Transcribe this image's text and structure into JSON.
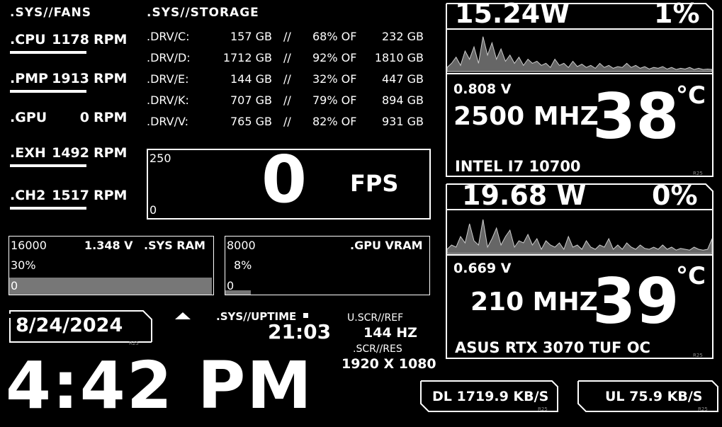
{
  "fans": {
    "header": ".SYS//FANS",
    "items": [
      {
        "label": ".CPU",
        "rpm": "1178",
        "unit": "RPM"
      },
      {
        "label": ".PMP",
        "rpm": "1913",
        "unit": "RPM"
      },
      {
        "label": ".GPU",
        "rpm": "0",
        "unit": "RPM"
      },
      {
        "label": ".EXH",
        "rpm": "1492",
        "unit": "RPM"
      },
      {
        "label": ".CH2",
        "rpm": "1517",
        "unit": "RPM"
      }
    ]
  },
  "storage": {
    "header": ".SYS//STORAGE",
    "drives": [
      {
        "name": ".DRV/C:",
        "used": "157 GB",
        "sep": "//",
        "pct": "68% OF",
        "total": "232 GB"
      },
      {
        "name": ".DRV/D:",
        "used": "1712 GB",
        "sep": "//",
        "pct": "92% OF",
        "total": "1810 GB"
      },
      {
        "name": ".DRV/E:",
        "used": "144 GB",
        "sep": "//",
        "pct": "32% OF",
        "total": "447 GB"
      },
      {
        "name": ".DRV/K:",
        "used": "707 GB",
        "sep": "//",
        "pct": "79% OF",
        "total": "894 GB"
      },
      {
        "name": ".DRV/V:",
        "used": "765 GB",
        "sep": "//",
        "pct": "82% OF",
        "total": "931 GB"
      }
    ]
  },
  "fps": {
    "max": "250",
    "min": "0",
    "value": "0",
    "unit": "FPS"
  },
  "ram": {
    "max": "16000",
    "voltage": "1.348 V",
    "label": ".SYS RAM",
    "pct": "30%",
    "min": "0",
    "fill": 1.0
  },
  "vram": {
    "max": "8000",
    "label": ".GPU VRAM",
    "pct": "8%",
    "min": "0",
    "fill": 0.08
  },
  "cpu": {
    "power": "15.24W",
    "load": "1%",
    "voltage": "0.808 V",
    "clock": "2500 MHZ",
    "temp": "38",
    "temp_unit": "°C",
    "name": "INTEL I7 10700",
    "tag": "R25",
    "graph": [
      0.1,
      0.2,
      0.35,
      0.15,
      0.5,
      0.3,
      0.6,
      0.2,
      0.85,
      0.4,
      0.7,
      0.3,
      0.55,
      0.25,
      0.4,
      0.2,
      0.35,
      0.15,
      0.3,
      0.2,
      0.25,
      0.15,
      0.2,
      0.1,
      0.3,
      0.15,
      0.2,
      0.1,
      0.25,
      0.12,
      0.18,
      0.1,
      0.15,
      0.08,
      0.2,
      0.1,
      0.15,
      0.08,
      0.12,
      0.1,
      0.2,
      0.1,
      0.15,
      0.08,
      0.12,
      0.06,
      0.1,
      0.08,
      0.12,
      0.06,
      0.1,
      0.05,
      0.08,
      0.06,
      0.1,
      0.05,
      0.08,
      0.05,
      0.06,
      0.05
    ]
  },
  "gpu": {
    "power": "19.68 W",
    "load": "0%",
    "voltage": "0.669 V",
    "clock": "210 MHZ",
    "temp": "39",
    "temp_unit": "°C",
    "name": "ASUS RTX 3070 TUF OC",
    "tag": "R25",
    "graph": [
      0.1,
      0.2,
      0.15,
      0.4,
      0.25,
      0.7,
      0.3,
      0.2,
      0.8,
      0.15,
      0.35,
      0.6,
      0.2,
      0.4,
      0.55,
      0.15,
      0.3,
      0.25,
      0.45,
      0.2,
      0.35,
      0.1,
      0.3,
      0.2,
      0.15,
      0.25,
      0.1,
      0.4,
      0.15,
      0.2,
      0.1,
      0.3,
      0.15,
      0.1,
      0.2,
      0.15,
      0.35,
      0.1,
      0.2,
      0.1,
      0.25,
      0.15,
      0.1,
      0.2,
      0.12,
      0.1,
      0.15,
      0.1,
      0.2,
      0.1,
      0.15,
      0.08,
      0.12,
      0.1,
      0.08,
      0.15,
      0.1,
      0.08,
      0.1,
      0.35
    ]
  },
  "date": {
    "value": "8/24/2024",
    "tag": "R25"
  },
  "time": {
    "value": "4:42 PM"
  },
  "uptime": {
    "label": ".SYS//UPTIME",
    "value": "21:03"
  },
  "screen": {
    "ref_label": "U.SCR//REF",
    "ref_value": "144 HZ",
    "res_label": ".SCR//RES",
    "res_value": "1920 X 1080"
  },
  "net": {
    "dl": "DL 1719.9 KB/S",
    "ul": "UL 75.9 KB/S",
    "tag": "R25"
  }
}
